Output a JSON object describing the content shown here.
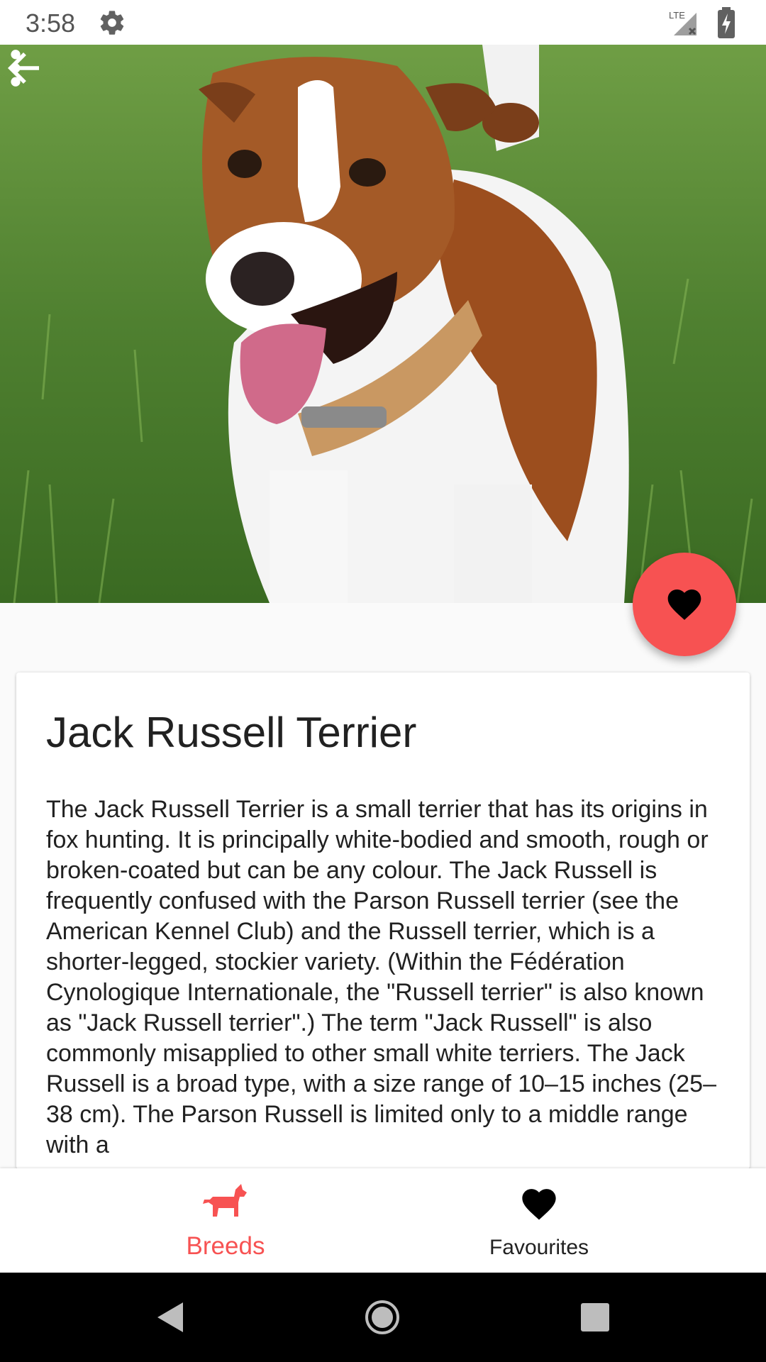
{
  "status_bar": {
    "time": "3:58",
    "icons": [
      "gear-icon",
      "signal-lte-icon",
      "battery-charging-icon"
    ],
    "network_label": "LTE"
  },
  "toolbar": {
    "back_icon": "arrow-back-icon",
    "more_icon": "more-vert-icon"
  },
  "fab": {
    "icon": "heart-icon",
    "color": "#f75252"
  },
  "breed": {
    "name": "Jack Russell Terrier",
    "description": "The Jack Russell Terrier is a small terrier that has its origins in fox hunting. It is principally white-bodied and smooth, rough or broken-coated but can be any colour. The Jack Russell is frequently confused with the Parson Russell terrier (see the American Kennel Club) and the Russell terrier, which is a shorter-legged, stockier variety. (Within the Fédération Cynologique Internationale, the \"Russell terrier\" is also known as \"Jack Russell terrier\".) The term \"Jack Russell\" is also commonly misapplied to other small white terriers. The Jack Russell is a broad type, with a size range of 10–15 inches (25–38 cm). The Parson Russell is limited only to a middle range with a"
  },
  "bottom_nav": {
    "items": [
      {
        "label": "Breeds",
        "icon": "dog-icon",
        "active": true
      },
      {
        "label": "Favourites",
        "icon": "heart-icon",
        "active": false
      }
    ],
    "accent": "#f75252"
  },
  "system_nav": {
    "icons": [
      "back-triangle-icon",
      "home-circle-icon",
      "recents-square-icon"
    ]
  }
}
